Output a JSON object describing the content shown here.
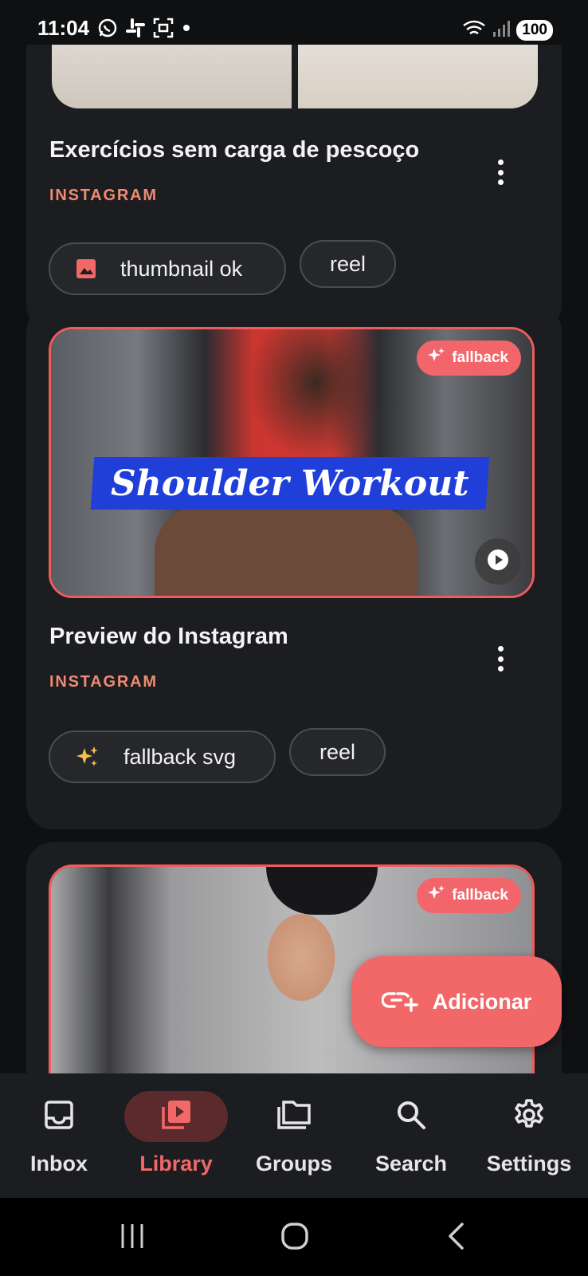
{
  "status_bar": {
    "time": "11:04",
    "battery": "100",
    "icons_left": [
      "whatsapp-icon",
      "slack-icon",
      "screenshot-icon",
      "dot-icon"
    ],
    "icons_right": [
      "wifi-icon",
      "signal-icon"
    ]
  },
  "cards": [
    {
      "title": "Exercícios sem carga de pescoço",
      "source": "INSTAGRAM",
      "chips": [
        "thumbnail ok",
        "reel"
      ]
    },
    {
      "title": "Preview do Instagram",
      "source": "INSTAGRAM",
      "badge": "fallback",
      "media_text": "Shoulder Workout",
      "chips": [
        "fallback svg",
        "reel"
      ]
    },
    {
      "badge": "fallback"
    }
  ],
  "fab": {
    "label": "Adicionar"
  },
  "nav": {
    "items": [
      {
        "label": "Inbox",
        "icon": "inbox-icon",
        "active": false
      },
      {
        "label": "Library",
        "icon": "library-icon",
        "active": true
      },
      {
        "label": "Groups",
        "icon": "folders-icon",
        "active": false
      },
      {
        "label": "Search",
        "icon": "search-icon",
        "active": false
      },
      {
        "label": "Settings",
        "icon": "gear-icon",
        "active": false
      }
    ]
  },
  "colors": {
    "accent": "#f26767",
    "source_text": "#f08a72",
    "card_bg": "#1c1d20",
    "page_bg": "#0f1012"
  }
}
